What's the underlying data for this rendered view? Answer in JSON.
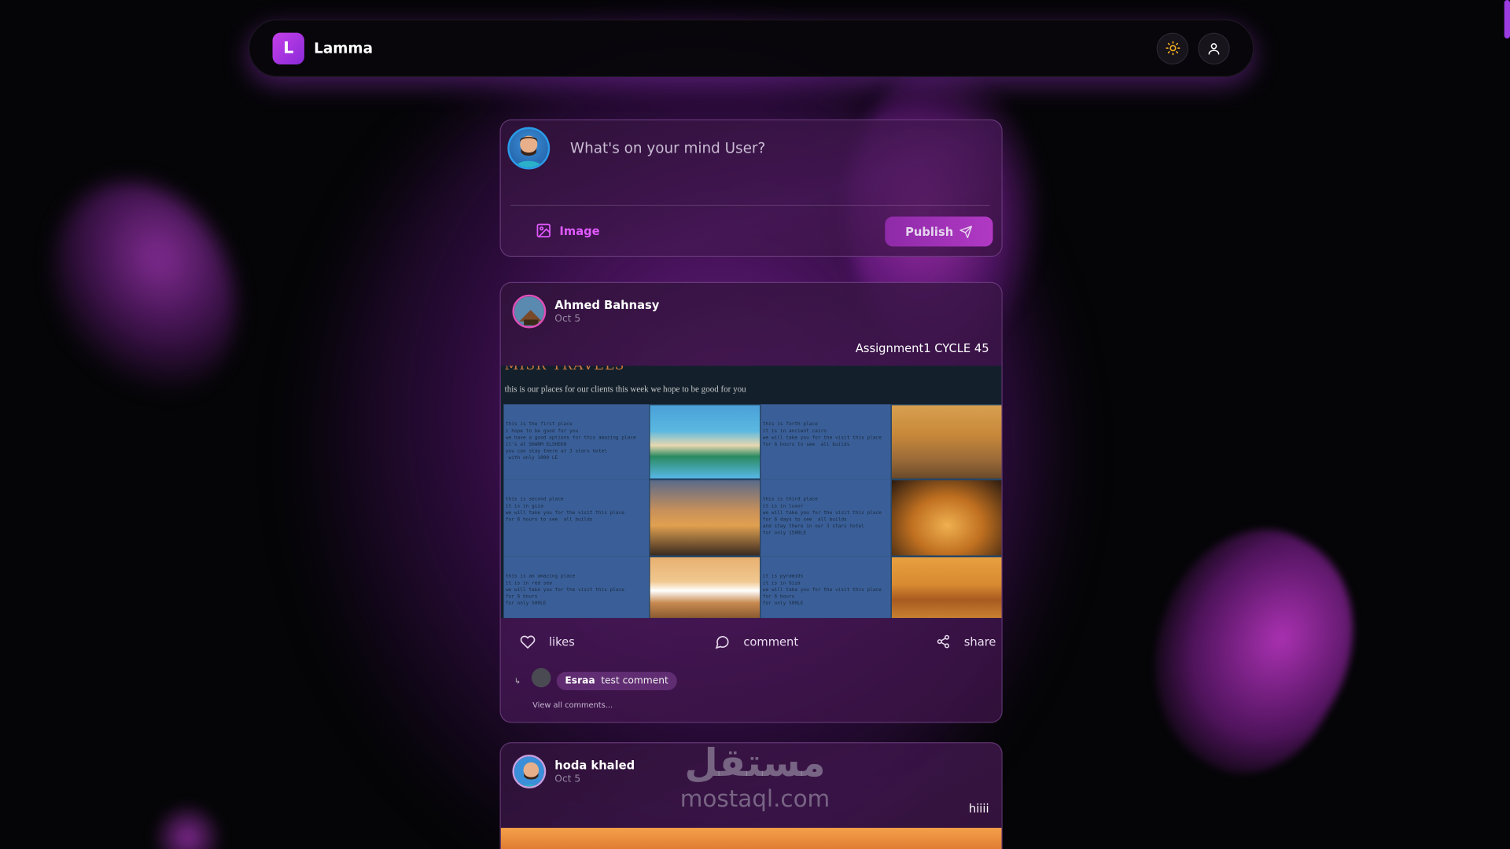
{
  "header": {
    "logo_letter": "L",
    "app_name": "Lamma"
  },
  "composer": {
    "placeholder": "What's on your mind User?",
    "image_label": "Image",
    "publish_label": "Publish"
  },
  "posts": [
    {
      "author": "Ahmed Bahnasy",
      "date": "Oct 5",
      "body": "Assignment1 CYCLE 45",
      "image": {
        "heading": "MISR TRAVELS",
        "subheading": "this is our places for our clients this week we hope to be good for you",
        "cells": [
          "this is the first place\ni hope to be good for you\nwe have a good options for this amazing place\nit's at SHARM ELSHEKH\nyou can stay there at 3 stars hotel\n with only 1000 LE",
          "this is forth place\nit is in ancient cairo\nwe will take you for the visit this place\nfor 6 hours to see  all builds",
          "this is second place\nit is in giza\nwe will take you for the visit this place\nfor 6 hours to see  all builds",
          "this is third place\nit is in luxor\nwe will take you for the visit this place\nfor 6 days to see  all builds\nand stay there in our 3 stars hotel\nfor only 1500LE",
          "this is an amazing place\nit is in red sea\nwe will take you for the visit this place\nfor 6 hours\nfor only 500LE",
          "it is pyramids\nit is in Giza\nwe will take you for the visit this place\nfor 6 hours\nfor only 500LE"
        ]
      },
      "actions": {
        "likes": "likes",
        "comment": "comment",
        "share": "share"
      },
      "comment": {
        "author": "Esraa",
        "text": "test comment"
      },
      "view_all": "View all comments..."
    },
    {
      "author": "hoda khaled",
      "date": "Oct 5",
      "body": "hiiii"
    }
  ],
  "watermark": {
    "arabic": "مستقل",
    "latin": "mostaql.com"
  }
}
